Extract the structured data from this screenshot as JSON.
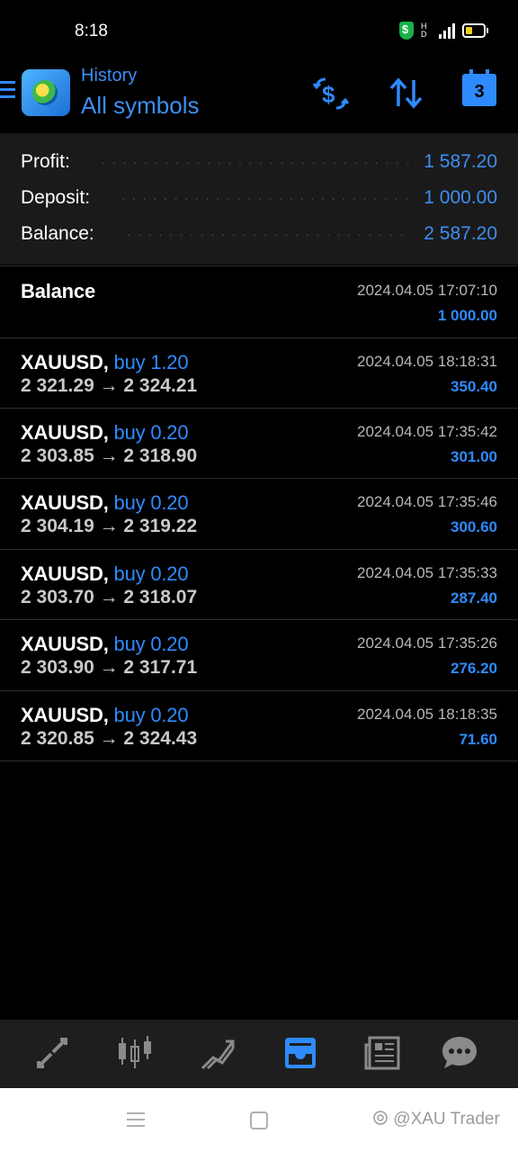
{
  "status": {
    "time": "8:18"
  },
  "header": {
    "subtitle": "History",
    "title": "All symbols",
    "calendar_day": "3"
  },
  "summary": [
    {
      "label": "Profit:",
      "value": "1 587.20"
    },
    {
      "label": "Deposit:",
      "value": "1 000.00"
    },
    {
      "label": "Balance:",
      "value": "2 587.20"
    }
  ],
  "balance_entry": {
    "label": "Balance",
    "time": "2024.04.05 17:07:10",
    "amount": "1 000.00"
  },
  "deals": [
    {
      "symbol": "XAUUSD,",
      "type": "buy 1.20",
      "prices": "2 321.29 → 2 324.21",
      "time": "2024.04.05 18:18:31",
      "profit": "350.40"
    },
    {
      "symbol": "XAUUSD,",
      "type": "buy 0.20",
      "prices": "2 303.85 → 2 318.90",
      "time": "2024.04.05 17:35:42",
      "profit": "301.00"
    },
    {
      "symbol": "XAUUSD,",
      "type": "buy 0.20",
      "prices": "2 304.19 → 2 319.22",
      "time": "2024.04.05 17:35:46",
      "profit": "300.60"
    },
    {
      "symbol": "XAUUSD,",
      "type": "buy 0.20",
      "prices": "2 303.70 → 2 318.07",
      "time": "2024.04.05 17:35:33",
      "profit": "287.40"
    },
    {
      "symbol": "XAUUSD,",
      "type": "buy 0.20",
      "prices": "2 303.90 → 2 317.71",
      "time": "2024.04.05 17:35:26",
      "profit": "276.20"
    },
    {
      "symbol": "XAUUSD,",
      "type": "buy 0.20",
      "prices": "2 320.85 → 2 324.43",
      "time": "2024.04.05 18:18:35",
      "profit": "71.60"
    }
  ],
  "tabs": [
    {
      "icon": "quotes-icon",
      "active": false
    },
    {
      "icon": "chart-icon",
      "active": false
    },
    {
      "icon": "trade-icon",
      "active": false
    },
    {
      "icon": "history-icon",
      "active": true
    },
    {
      "icon": "news-icon",
      "active": false
    },
    {
      "icon": "messages-icon",
      "active": false
    }
  ],
  "watermark": "@XAU Trader",
  "colors": {
    "accent": "#2e8bff",
    "background": "#000000",
    "panel": "#1a1a1a"
  }
}
